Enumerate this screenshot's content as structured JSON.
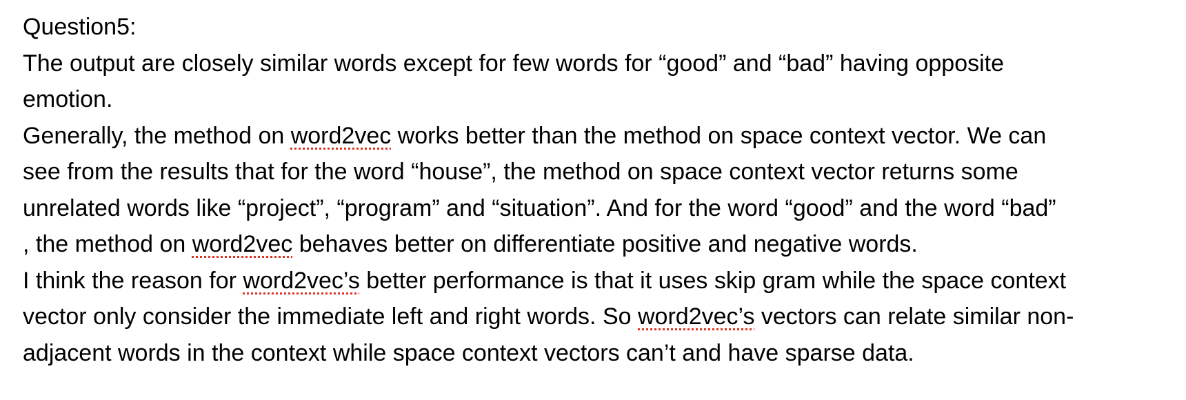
{
  "document": {
    "heading": "Question5:",
    "paragraph1": {
      "line1": "The output are closely similar words except for few words for “good” and “bad” having opposite",
      "line2": "emotion."
    },
    "paragraph2": {
      "line1_a": "Generally, the method on ",
      "line1_b": "word2vec",
      "line1_c": " works better than the method on space context vector. We can",
      "line2": "see from the results that for the word “house”, the method on space context vector returns some",
      "line3": "unrelated words like “project”, “program” and “situation”. And for the word “good” and the word “bad”",
      "line4_a": ", the method on ",
      "line4_b": "word2vec",
      "line4_c": " behaves better on differentiate positive and negative words."
    },
    "paragraph3": {
      "line1_a": "I think the reason for ",
      "line1_b": "word2vec’s",
      "line1_c": " better performance is that it uses skip gram while the space context",
      "line2_a": "vector only consider the immediate left and right words. So ",
      "line2_b": "word2vec’s",
      "line2_c": " vectors can relate similar non-",
      "line3": "adjacent words in the context while space context vectors can’t and have sparse data."
    }
  },
  "colors": {
    "text": "#000000",
    "spellcheck_underline": "#e0301e",
    "background": "#ffffff"
  }
}
